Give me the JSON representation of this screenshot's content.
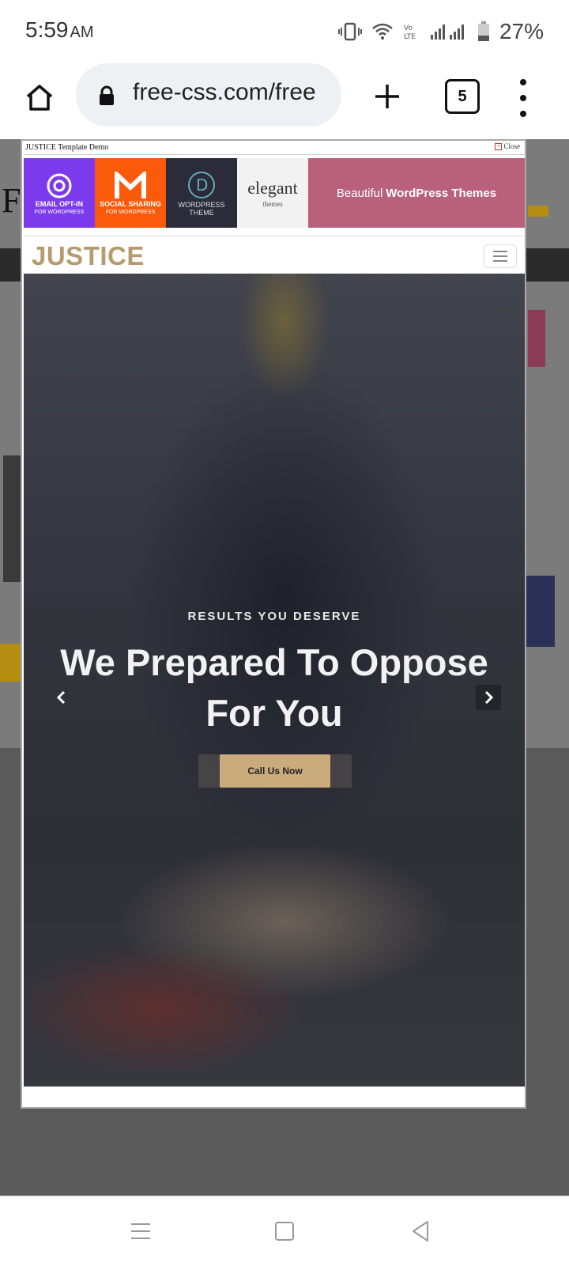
{
  "status_bar": {
    "time": "5:59",
    "ampm": "AM",
    "battery": "27%"
  },
  "browser": {
    "url": "free-css.com/free",
    "tab_count": "5"
  },
  "modal": {
    "title": "JUSTICE Template Demo",
    "close_label": "Close"
  },
  "ad": {
    "tiles": [
      {
        "title": "EMAIL OPT-IN",
        "sub": "FOR WORDPRESS"
      },
      {
        "title": "SOCIAL SHARING",
        "sub": "FOR WORDPRESS"
      },
      {
        "title": "WORDPRESS THEME"
      },
      {
        "title": "elegant",
        "sub": "themes"
      }
    ],
    "banner_prefix": "Beautiful",
    "banner_bold": "WordPress Themes"
  },
  "site": {
    "brand": "JUSTICE",
    "hero": {
      "subtitle": "RESULTS YOU DESERVE",
      "headline_line1": "We Prepared To Oppose",
      "headline_line2": "For You",
      "cta": "Call Us Now"
    }
  },
  "colors": {
    "brand": "#b59b6e",
    "cta": "#c9ab7c"
  }
}
